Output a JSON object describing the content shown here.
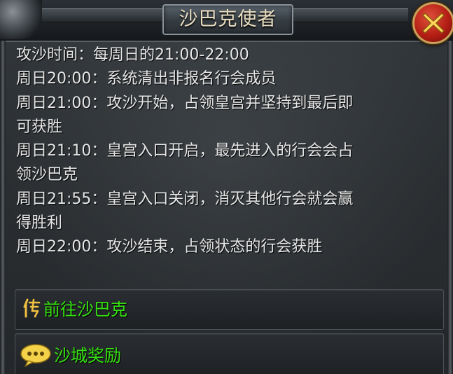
{
  "dialog": {
    "title": "沙巴克使者",
    "close_icon": "close-x-icon"
  },
  "info_lines": [
    "攻沙时间：每周日的21:00-22:00",
    "周日20:00：系统清出非报名行会成员",
    "周日21:00：攻沙开始，占领皇宫并坚持到最后即",
    "可获胜",
    "周日21:10：皇宫入口开启，最先进入的行会会占",
    "领沙巴克",
    "周日21:55：皇宫入口关闭，消灭其他行会就会赢",
    "得胜利",
    "周日22:00：攻沙结束，占领状态的行会获胜"
  ],
  "actions": {
    "goto": {
      "label": "前往沙巴克",
      "icon": "legend-seal-icon"
    },
    "reward": {
      "label": "沙城奖励",
      "icon": "chat-bubble-icon"
    }
  },
  "colors": {
    "text": "#e6e6e6",
    "action_text": "#35e20f",
    "title_text": "#e8dcc0",
    "close_button": "#b41e14"
  }
}
